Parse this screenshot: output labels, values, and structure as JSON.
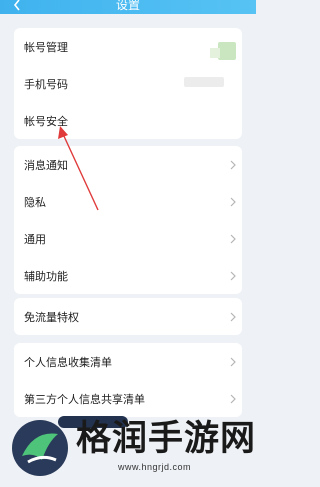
{
  "header": {
    "title": "设置",
    "back_icon": "back-arrow-icon"
  },
  "group1": {
    "items": [
      {
        "label": "帐号管理"
      },
      {
        "label": "手机号码"
      },
      {
        "label": "帐号安全"
      }
    ]
  },
  "group2": {
    "items": [
      {
        "label": "消息通知"
      },
      {
        "label": "隐私"
      },
      {
        "label": "通用"
      },
      {
        "label": "辅助功能"
      }
    ]
  },
  "group3": {
    "items": [
      {
        "label": "免流量特权"
      }
    ]
  },
  "group4": {
    "items": [
      {
        "label": "个人信息收集清单"
      },
      {
        "label": "第三方个人信息共享清单"
      }
    ]
  },
  "watermark": {
    "text": "格润手游网",
    "url": "www.hngrjd.com"
  },
  "colors": {
    "header_bg": "#3fb2ee",
    "annotation_arrow": "#e03a3a",
    "page_bg": "#eef1f5"
  }
}
